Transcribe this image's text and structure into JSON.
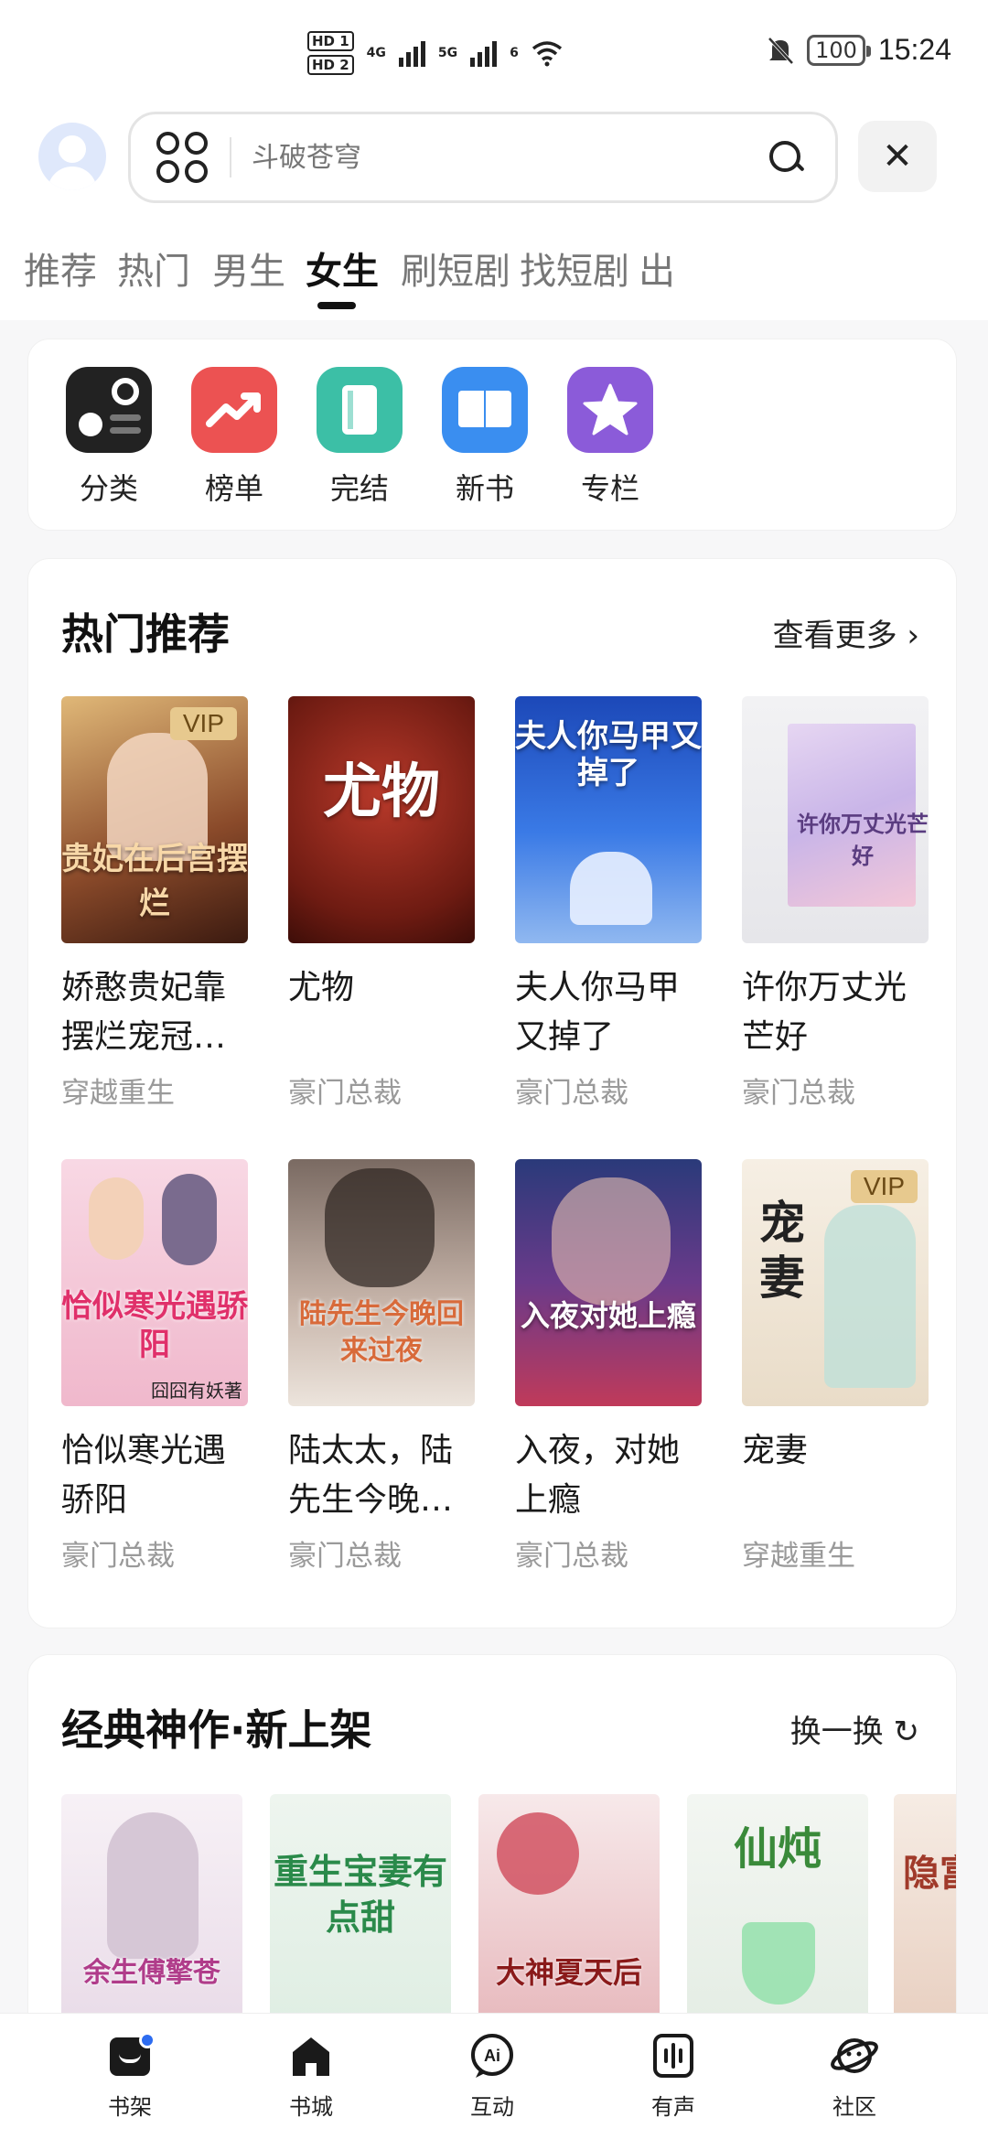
{
  "status": {
    "hd1": "HD 1",
    "hd2": "HD 2",
    "net1": "4G",
    "net2": "5G",
    "net3": "6",
    "battery": "100",
    "time": "15:24"
  },
  "search": {
    "placeholder": "斗破苍穹"
  },
  "tabs": [
    "推荐",
    "热门",
    "男生",
    "女生",
    "刷短剧",
    "找短剧",
    "出"
  ],
  "quick": [
    {
      "label": "分类",
      "color": "#222222"
    },
    {
      "label": "榜单",
      "color": "#ec5252"
    },
    {
      "label": "完结",
      "color": "#3cbfa6"
    },
    {
      "label": "新书",
      "color": "#3a8ef0"
    },
    {
      "label": "专栏",
      "color": "#8b5bd9"
    }
  ],
  "hot": {
    "title": "热门推荐",
    "more": "查看更多",
    "books": [
      {
        "title": "娇憨贵妃靠摆烂宠冠…",
        "tag": "穿越重生",
        "vip": "VIP",
        "cover_text": "贵妃在后宫摆烂"
      },
      {
        "title": "尤物",
        "tag": "豪门总裁",
        "cover_text": "尤物"
      },
      {
        "title": "夫人你马甲又掉了",
        "tag": "豪门总裁",
        "cover_text": "夫人你马甲又掉了"
      },
      {
        "title": "许你万丈光芒好",
        "tag": "豪门总裁",
        "cover_text": "许你万丈光芒好"
      },
      {
        "title": "恰似寒光遇骄阳",
        "tag": "豪门总裁",
        "cover_text": "恰似寒光遇骄阳",
        "cover_author": "囧囧有妖著"
      },
      {
        "title": "陆太太，陆先生今晚…",
        "tag": "豪门总裁",
        "cover_text": "陆先生今晚回来过夜"
      },
      {
        "title": "入夜，对她上瘾",
        "tag": "豪门总裁",
        "cover_text": "入夜对她上瘾"
      },
      {
        "title": "宠妻",
        "tag": "穿越重生",
        "vip": "VIP",
        "cover_text": "宠妻"
      }
    ]
  },
  "classic": {
    "title": "经典神作·新上架",
    "more": "换一换",
    "covers": [
      {
        "cover_text": "余生傅擎苍"
      },
      {
        "cover_text": "重生宝妻有点甜"
      },
      {
        "cover_text": "大神夏天后"
      },
      {
        "cover_text": "仙炖"
      },
      {
        "cover_text": "隐富"
      }
    ]
  },
  "nav": [
    "书架",
    "书城",
    "互动",
    "有声",
    "社区"
  ]
}
